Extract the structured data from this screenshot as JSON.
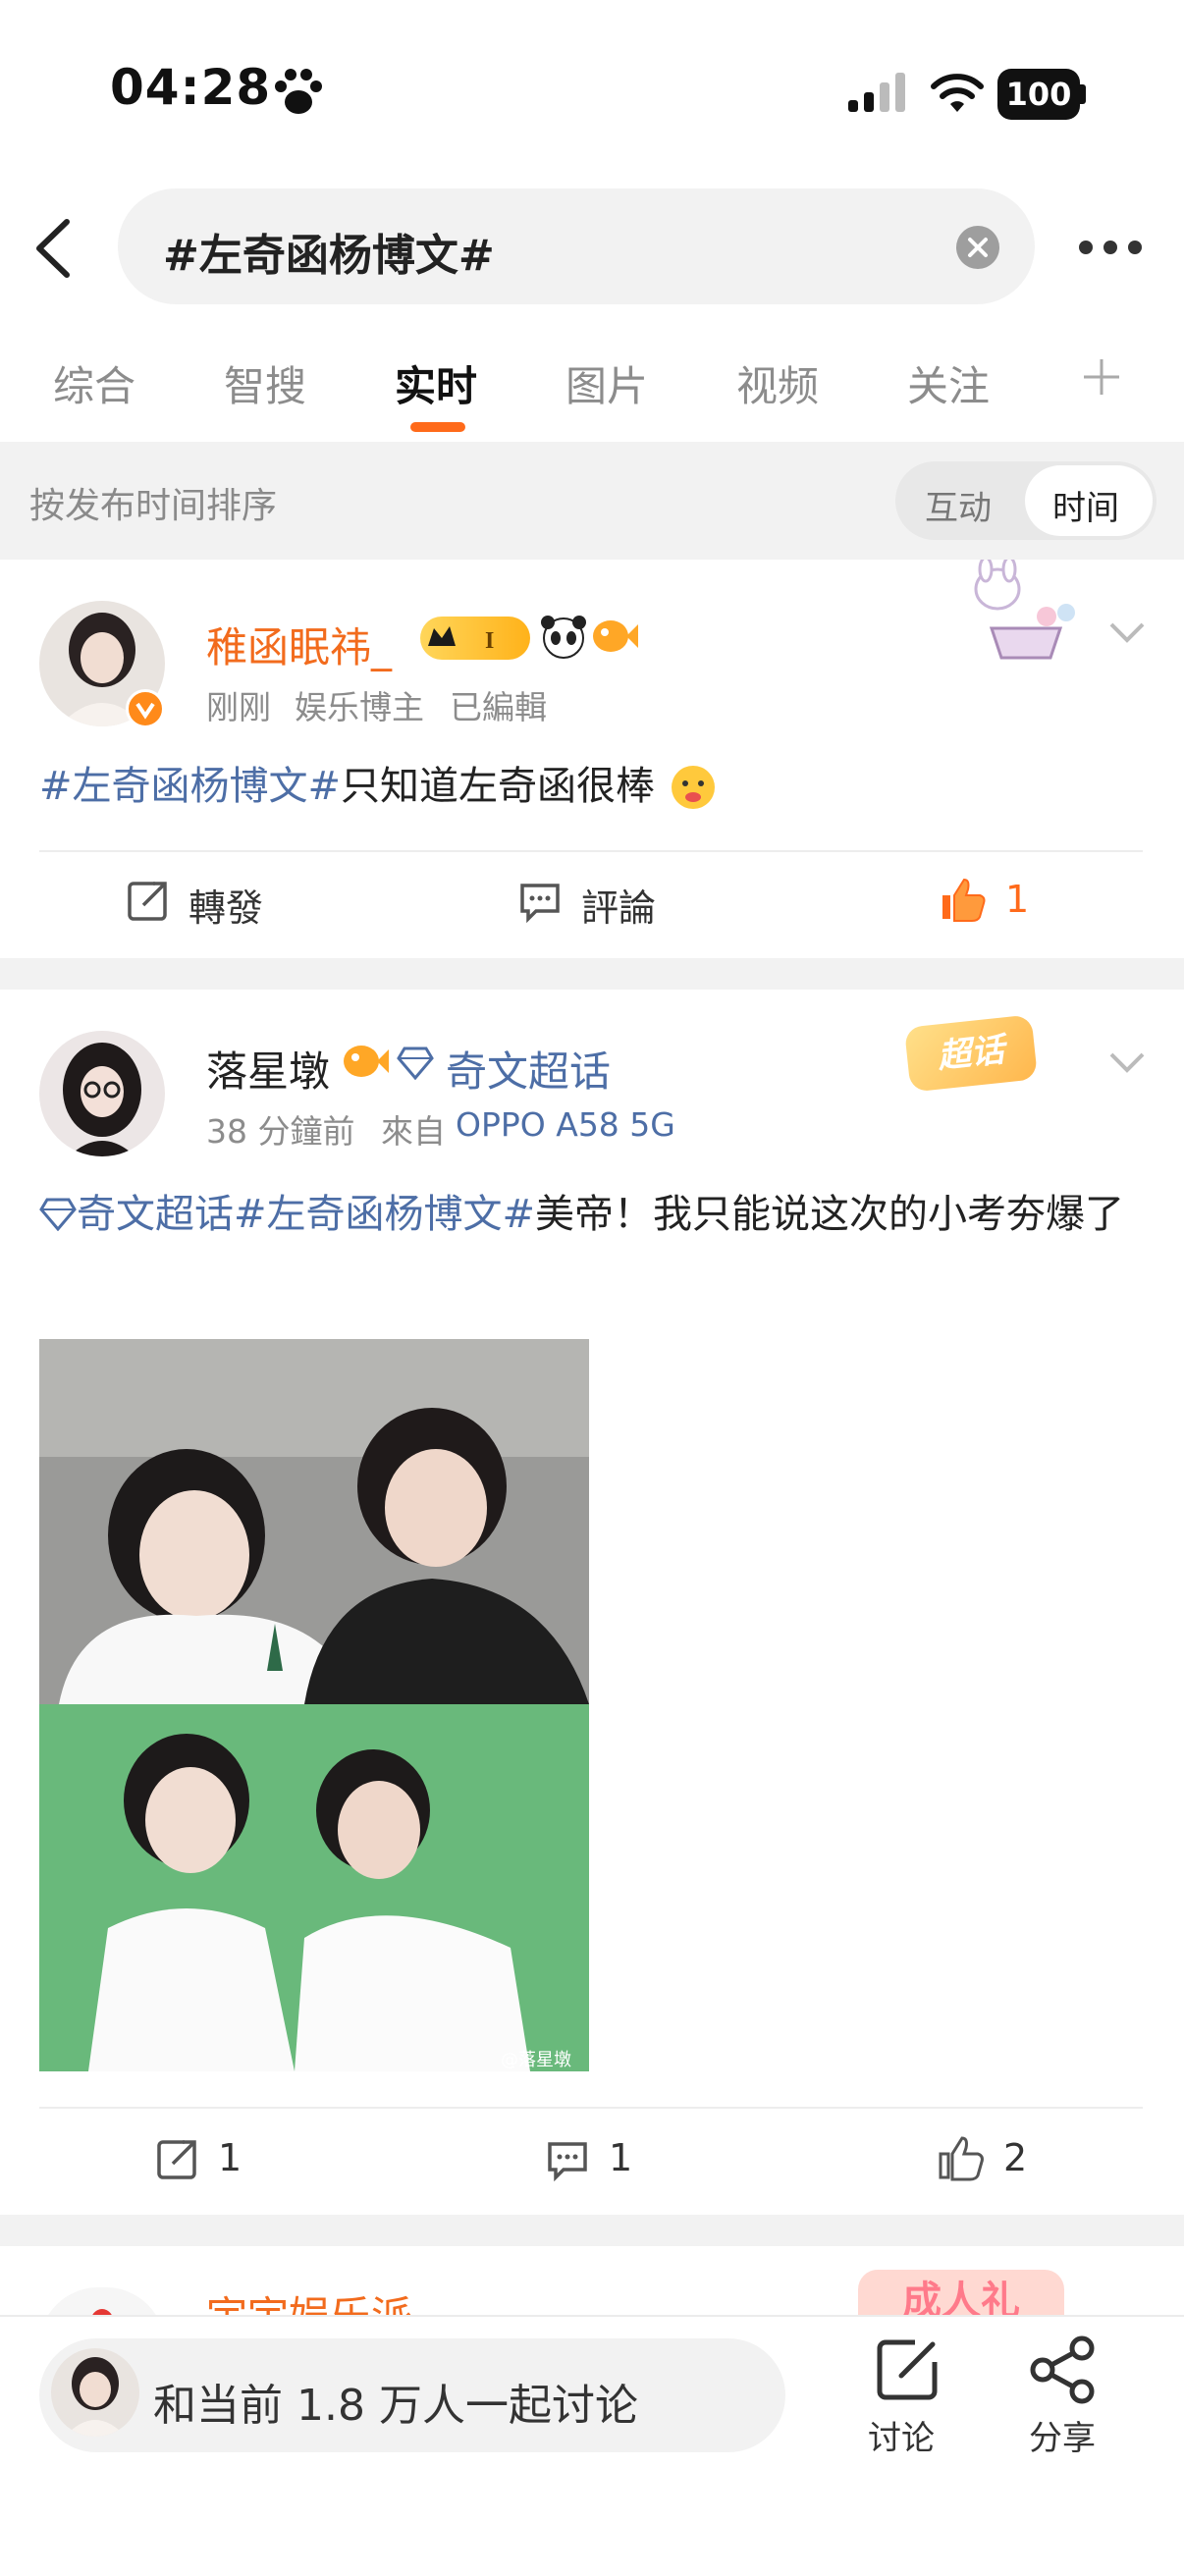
{
  "status": {
    "time": "04:28",
    "battery": "100"
  },
  "search": {
    "query": "#左奇函杨博文#"
  },
  "tabs": [
    "综合",
    "智搜",
    "实时",
    "图片",
    "视频",
    "关注"
  ],
  "sort": {
    "label": "按发布时间排序",
    "options": [
      "互动",
      "时间"
    ],
    "selected": "时间"
  },
  "posts": [
    {
      "username": "稚函眠祎_",
      "meta": [
        "刚刚",
        "娱乐博主",
        "已編輯"
      ],
      "topic": "#左奇函杨博文#",
      "text": "只知道左奇函很棒",
      "actions": {
        "repost": "轉發",
        "comment": "評論",
        "like": "1"
      },
      "colors": {
        "username": "#f26b1d",
        "like": "#ff6a1a"
      }
    },
    {
      "username": "落星墩",
      "supertopic": "奇文超话",
      "badge": "超话",
      "meta": [
        "38 分鐘前",
        "來自",
        "OPPO A58 5G"
      ],
      "topic_super": "奇文超话",
      "topic": "#左奇函杨博文#",
      "text": "美帝！我只能说这次的小考夯爆了",
      "watermark": "@落星墩",
      "actions": {
        "repost": "1",
        "comment": "1",
        "like": "2"
      }
    },
    {
      "username": "宇宇娱乐派",
      "badge": "成人礼"
    }
  ],
  "bottom": {
    "discuss": "和当前 1.8 万人一起讨论",
    "discuss_btn": "讨论",
    "share_btn": "分享"
  }
}
